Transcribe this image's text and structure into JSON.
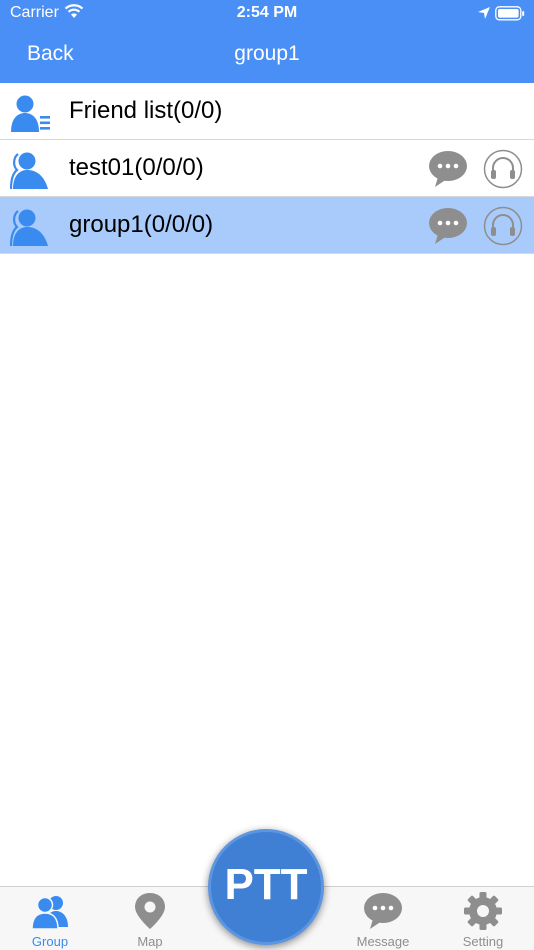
{
  "status": {
    "carrier": "Carrier",
    "time": "2:54 PM"
  },
  "nav": {
    "back_label": "Back",
    "title": "group1"
  },
  "list": [
    {
      "label": "Friend list(0/0)",
      "icon": "friend-list-icon",
      "selected": false
    },
    {
      "label": "test01(0/0/0)",
      "icon": "user-group-icon",
      "selected": false
    },
    {
      "label": "group1(0/0/0)",
      "icon": "user-group-icon",
      "selected": true
    }
  ],
  "tabs": {
    "group": "Group",
    "map": "Map",
    "message": "Message",
    "setting": "Setting"
  },
  "ptt_label": "PTT",
  "colors": {
    "accent": "#4a8ff5",
    "selected_row": "#a9cbfb",
    "icon_gray": "#8e8e8e",
    "ptt": "#3f7fd4"
  }
}
